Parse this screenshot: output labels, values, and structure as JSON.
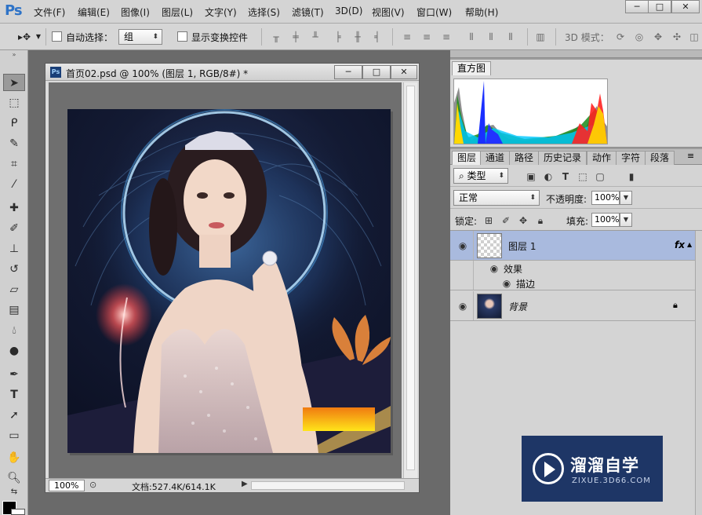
{
  "app": {
    "logo": "Ps"
  },
  "menu": [
    "文件(F)",
    "编辑(E)",
    "图像(I)",
    "图层(L)",
    "文字(Y)",
    "选择(S)",
    "滤镜(T)",
    "3D(D)",
    "视图(V)",
    "窗口(W)",
    "帮助(H)"
  ],
  "window_controls": {
    "minimize": "─",
    "maximize": "□",
    "close": "✕"
  },
  "options": {
    "auto_select_label": "自动选择：",
    "auto_select_value": "组",
    "show_transform_label": "显示变换控件",
    "mode_3d_label": "3D 模式："
  },
  "document": {
    "title": "首页02.psd @ 100% (图层 1, RGB/8#) *",
    "zoom": "100%",
    "info": "文档:527.4K/614.1K"
  },
  "histogram": {
    "tab": "直方图"
  },
  "layers_panel": {
    "tabs": [
      "图层",
      "通道",
      "路径",
      "历史记录",
      "动作",
      "字符",
      "段落"
    ],
    "filter_label": "类型",
    "blend_mode": "正常",
    "opacity_label": "不透明度:",
    "opacity_value": "100%",
    "lock_label": "锁定:",
    "fill_label": "填充:",
    "fill_value": "100%",
    "layers": [
      {
        "name": "图层 1",
        "fx": "fx",
        "effects_label": "效果",
        "effect_item": "描边"
      },
      {
        "name": "背景"
      }
    ]
  },
  "watermark": {
    "cn": "溜溜自学",
    "en": "ZIXUE.3D66.COM"
  },
  "colors": {
    "selected_layer": "#a9bade",
    "ps_blue": "#2e73c7"
  }
}
